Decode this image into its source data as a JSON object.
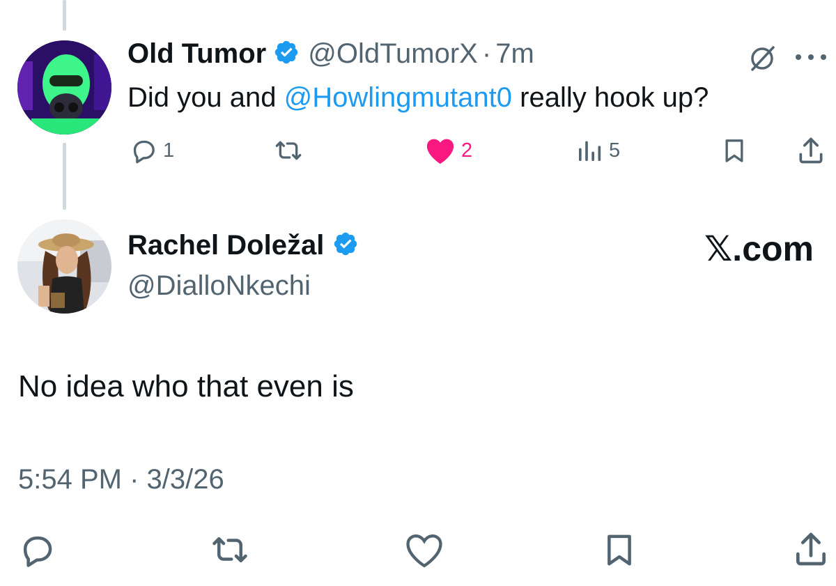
{
  "colors": {
    "text": "#0f1419",
    "muted": "#536471",
    "link": "#1d9bf0",
    "verified": "#1d9bf0",
    "like": "#f91880",
    "thread_line": "#cfd9de"
  },
  "reply": {
    "author_name": "Old Tumor",
    "handle": "@OldTumorX",
    "separator": "·",
    "time_ago": "7m",
    "text_before_mention": "Did you and ",
    "mention": "@Howlingmutant0",
    "text_after_mention": " really hook up?",
    "actions": {
      "replies": "1",
      "likes": "2",
      "views": "5"
    },
    "icons": {
      "grok": "grok-icon",
      "more": "more-icon",
      "reply": "reply-icon",
      "retweet": "retweet-icon",
      "like": "heart-filled-icon",
      "views": "views-icon",
      "bookmark": "bookmark-icon",
      "share": "share-icon"
    }
  },
  "main_post": {
    "author_name": "Rachel Doležal",
    "handle": "@DialloNkechi",
    "watermark": "𝕏.com",
    "text": "No idea who that even is",
    "timestamp": "5:54 PM · 3/3/26",
    "icons": {
      "reply": "reply-icon",
      "retweet": "retweet-icon",
      "like": "heart-outline-icon",
      "bookmark": "bookmark-icon",
      "share": "share-icon"
    }
  }
}
